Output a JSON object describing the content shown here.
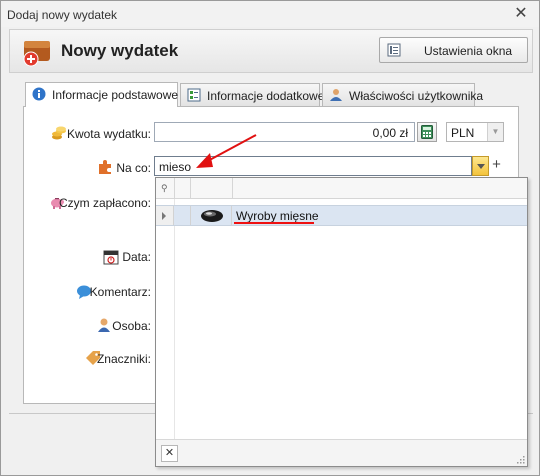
{
  "window": {
    "title": "Dodaj nowy wydatek",
    "close_symbol": "✕"
  },
  "header": {
    "title": "Nowy wydatek",
    "settings_label": "Ustawienia okna"
  },
  "tabs": [
    {
      "label": "Informacje podstawowe",
      "icon": "info-icon"
    },
    {
      "label": "Informacje dodatkowe",
      "icon": "list-icon"
    },
    {
      "label": "Właściwości użytkownika",
      "icon": "user-icon"
    }
  ],
  "form": {
    "amount": {
      "label": "Kwota wydatku:",
      "value": "0,00 zł",
      "currency": "PLN"
    },
    "category": {
      "label": "Na co:",
      "value": "mieso"
    },
    "paid_with": {
      "label": "Czym zapłacono:"
    },
    "date": {
      "label": "Data:"
    },
    "comment": {
      "label": "Komentarz:"
    },
    "person": {
      "label": "Osoba:"
    },
    "tags": {
      "label": "Znaczniki:"
    }
  },
  "dropdown": {
    "results": [
      {
        "label": "Wyroby mięsne",
        "icon": "meat-icon"
      }
    ],
    "close_symbol": "✕"
  },
  "colors": {
    "annotation": "#e11111",
    "selected_row": "#dbe5f2",
    "dropdown_button": "#f3c33c"
  }
}
